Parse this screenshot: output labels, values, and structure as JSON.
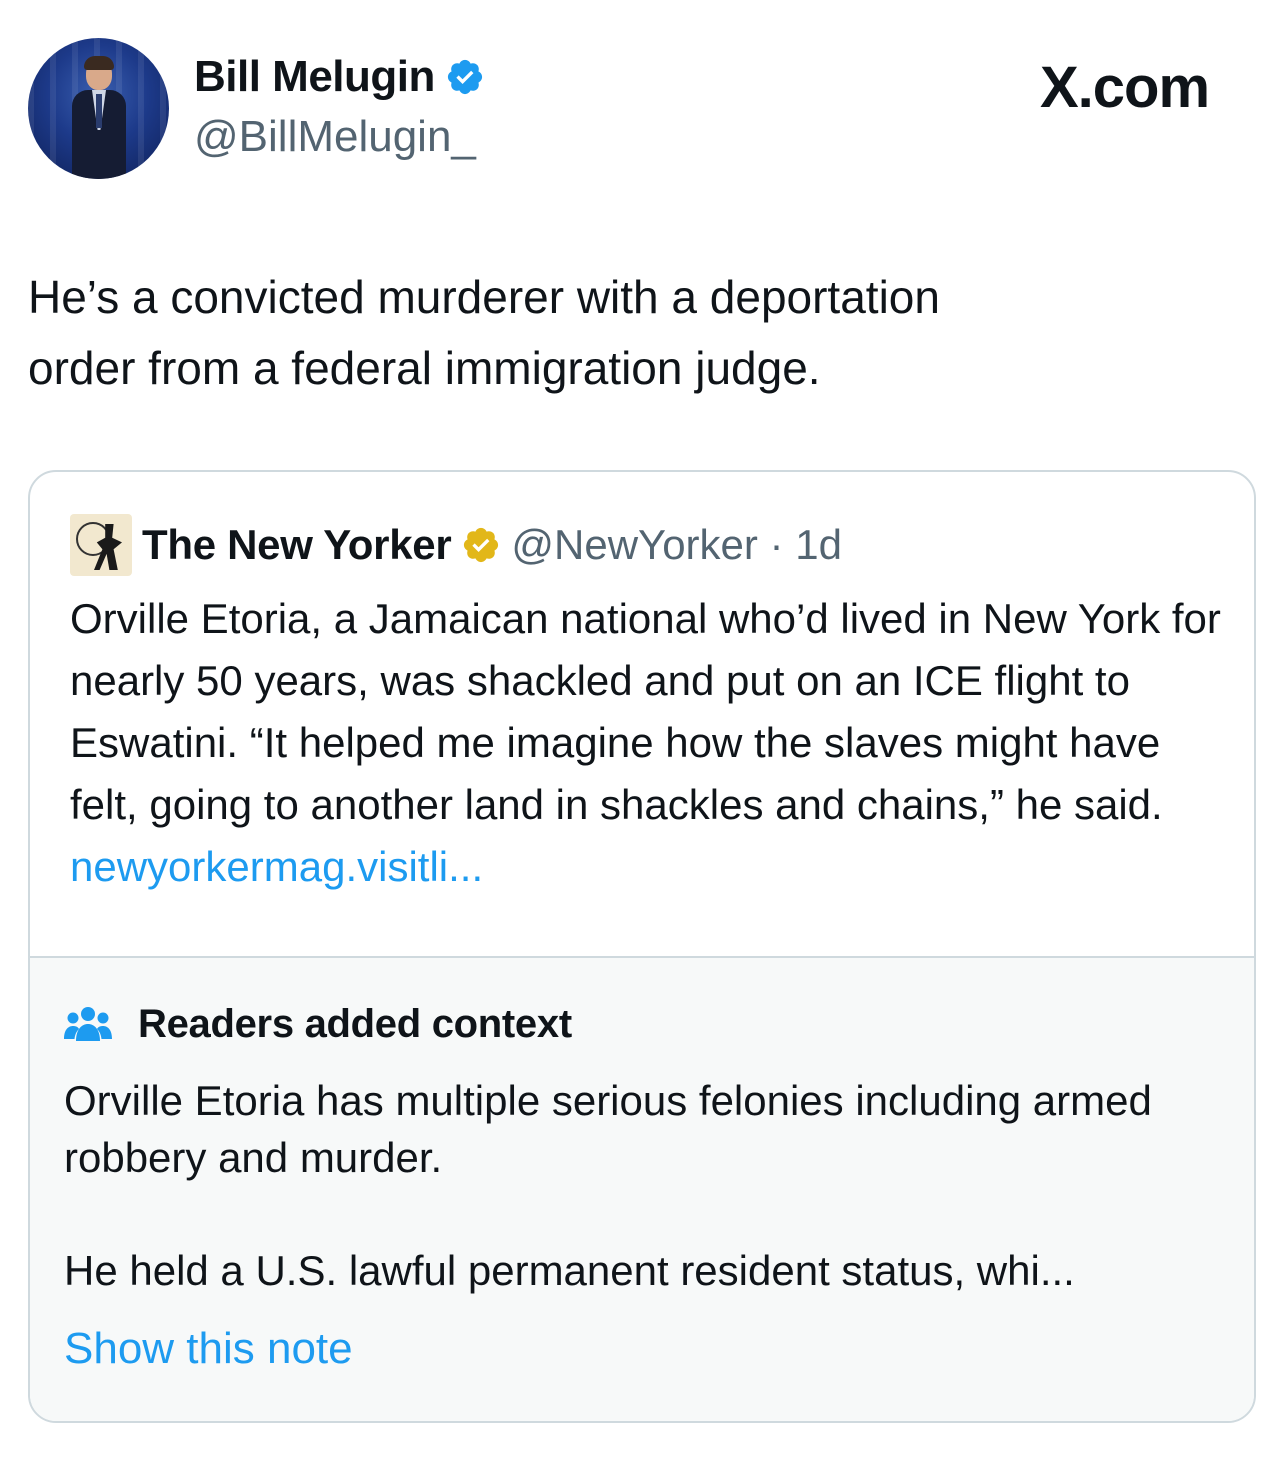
{
  "author": {
    "display_name": "Bill Melugin",
    "handle": "@BillMelugin_",
    "verified_icon": "blue-verified-badge"
  },
  "brand": "X.com",
  "tweet": {
    "text_line1": "He’s a convicted murderer with a deportation",
    "text_line2": "order from a federal immigration judge."
  },
  "quoted_tweet": {
    "display_name": "The New Yorker",
    "verified_icon": "gold-verified-badge",
    "handle": "@NewYorker",
    "separator": " · ",
    "time": "1d",
    "text": "Orville Etoria, a Jamaican national who’d lived in New York for nearly 50 years, was shackled and put on an ICE flight to Eswatini. “It helped me imagine how the slaves might have felt, going to another land in shackles and chains,” he said. ",
    "link": "newyorkermag.visitli..."
  },
  "community_note": {
    "icon": "people-icon",
    "title": "Readers added context",
    "paragraph1": "Orville Etoria has multiple serious felonies including armed robbery and murder.",
    "paragraph2": "He held a U.S. lawful permanent resident status, whi...",
    "show_label": "Show this note"
  },
  "colors": {
    "text_primary": "#0f1419",
    "text_secondary": "#536471",
    "link_blue": "#1d9bf0",
    "verified_blue": "#1d9bf0",
    "verified_gold": "#e2b719",
    "border": "#cfd9de",
    "note_bg": "#f7f9f9"
  }
}
